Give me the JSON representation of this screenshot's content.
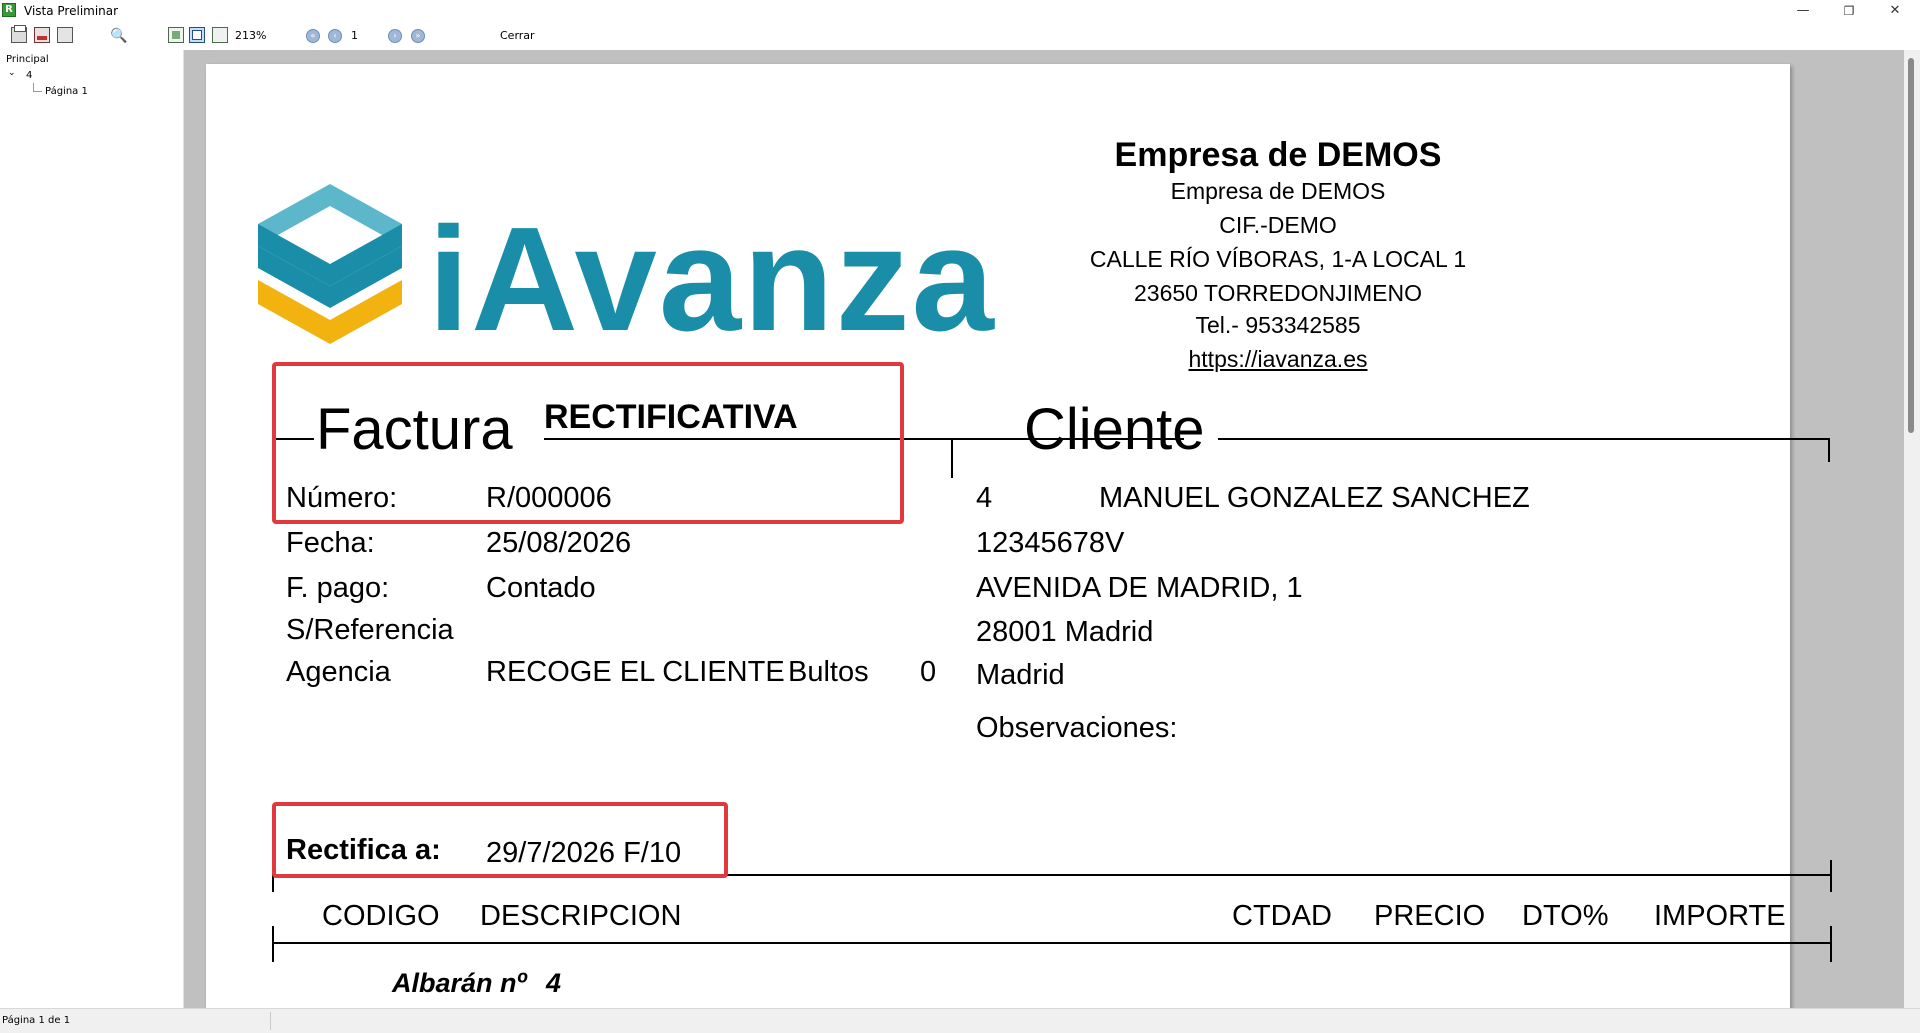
{
  "window": {
    "title": "Vista Preliminar",
    "app_icon_letter": "R",
    "minimize_glyph": "—",
    "restore_glyph": "❐",
    "close_glyph": "✕"
  },
  "toolbar": {
    "zoom": "213%",
    "page_value": "1",
    "close_label": "Cerrar",
    "nav_first": "«",
    "nav_prev": "‹",
    "nav_next": "›",
    "nav_last": "»",
    "find_glyph": "🔍"
  },
  "tree": {
    "root": "Principal",
    "node": "4",
    "child": "Página 1"
  },
  "status": {
    "text": "Página 1 de 1"
  },
  "colors": {
    "brand_teal": "#1a8ea8",
    "brand_yellow": "#f2b20f",
    "brand_light": "#5bb7c9",
    "highlight_red": "#e03a3e"
  },
  "document": {
    "logo_text": "iAvanza",
    "company": {
      "name_bold": "Empresa de DEMOS",
      "name": "Empresa de DEMOS",
      "cif": "CIF.-DEMO",
      "address": "CALLE RÍO VÍBORAS, 1-A LOCAL 1",
      "city": "23650 TORREDONJIMENO",
      "phone": "Tel.- 953342585",
      "web": "https://iavanza.es"
    },
    "invoice": {
      "heading": "Factura",
      "type": "RECTIFICATIVA",
      "numero_label": "Número:",
      "numero": "R/000006",
      "fecha_label": "Fecha:",
      "fecha": "25/08/2026",
      "pago_label": "F. pago:",
      "pago": "Contado",
      "sref_label": "S/Referencia",
      "agencia_label": "Agencia",
      "agencia": "RECOGE EL CLIENTE",
      "bultos_label": "Bultos",
      "bultos": "0"
    },
    "client": {
      "heading": "Cliente",
      "code": "4",
      "name": "MANUEL GONZALEZ SANCHEZ",
      "nif": "12345678V",
      "address": "AVENIDA DE MADRID, 1",
      "city": "28001 Madrid",
      "province": "Madrid",
      "obs_label": "Observaciones:"
    },
    "rectifica": {
      "label": "Rectifica a:",
      "value": "29/7/2026 F/10"
    },
    "table_headers": {
      "codigo": "CODIGO",
      "descripcion": "DESCRIPCION",
      "ctdad": "CTDAD",
      "precio": "PRECIO",
      "dto": "DTO%",
      "importe": "IMPORTE"
    },
    "albaran": {
      "label": "Albarán nº",
      "number": "4"
    }
  }
}
